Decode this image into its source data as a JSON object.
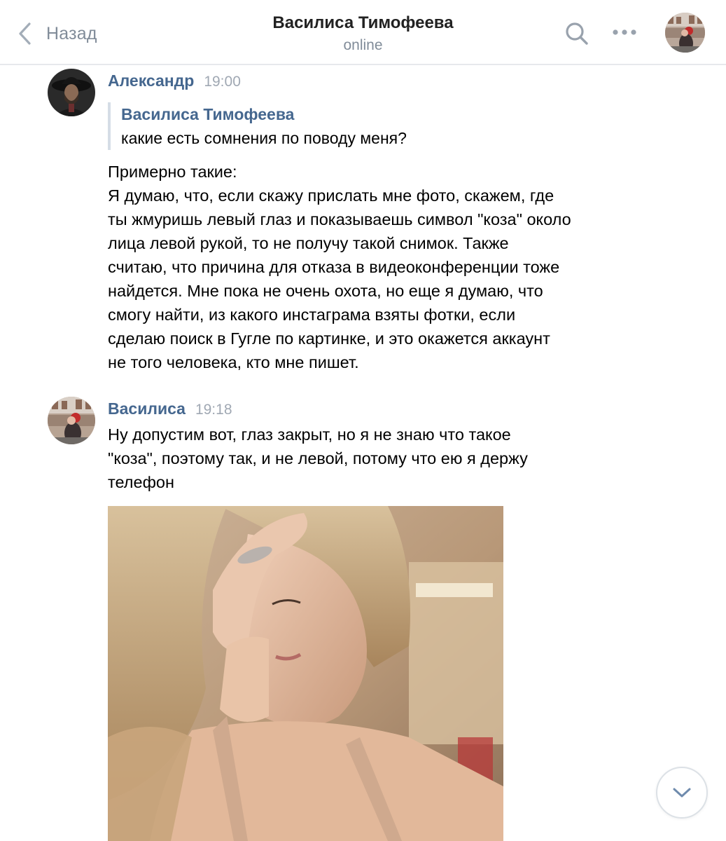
{
  "header": {
    "back_label": "Назад",
    "title": "Василиса Тимофеева",
    "status": "online"
  },
  "icons": {
    "back": "chevron-left-icon",
    "search": "search-icon",
    "more": "more-horizontal-icon",
    "scroll_down": "chevron-down-icon"
  },
  "messages": [
    {
      "author": "Александр",
      "time": "19:00",
      "quote": {
        "author": "Василиса Тимофеева",
        "text": "какие есть сомнения по поводу меня?"
      },
      "text": "Примерно такие:\nЯ думаю, что, если скажу прислать мне фото, скажем, где\nты жмуришь левый глаз и показываешь символ \"коза\" около\nлица левой рукой, то не получу такой снимок. Также\nсчитаю, что причина для отказа в видеоконференции тоже\nнайдется. Мне пока не очень охота, но еще я думаю, что\nсмогу найти, из какого инстаграма взяты фотки, если\nсделаю поиск в Гугле по картинке, и это окажется аккаунт\nне того человека, кто мне пишет."
    },
    {
      "author": "Василиса",
      "time": "19:18",
      "text": "Ну допустим вот, глаз закрыт, но я не знаю что такое\n\"коза\", поэтому так, и не левой, потому что ею я держу\nтелефон"
    }
  ],
  "colors": {
    "link_blue": "#45678f",
    "muted_gray": "#818c99",
    "timestamp_gray": "#a0a8b3",
    "quote_bar": "#d5dde6",
    "divider": "#e7e8ec"
  }
}
